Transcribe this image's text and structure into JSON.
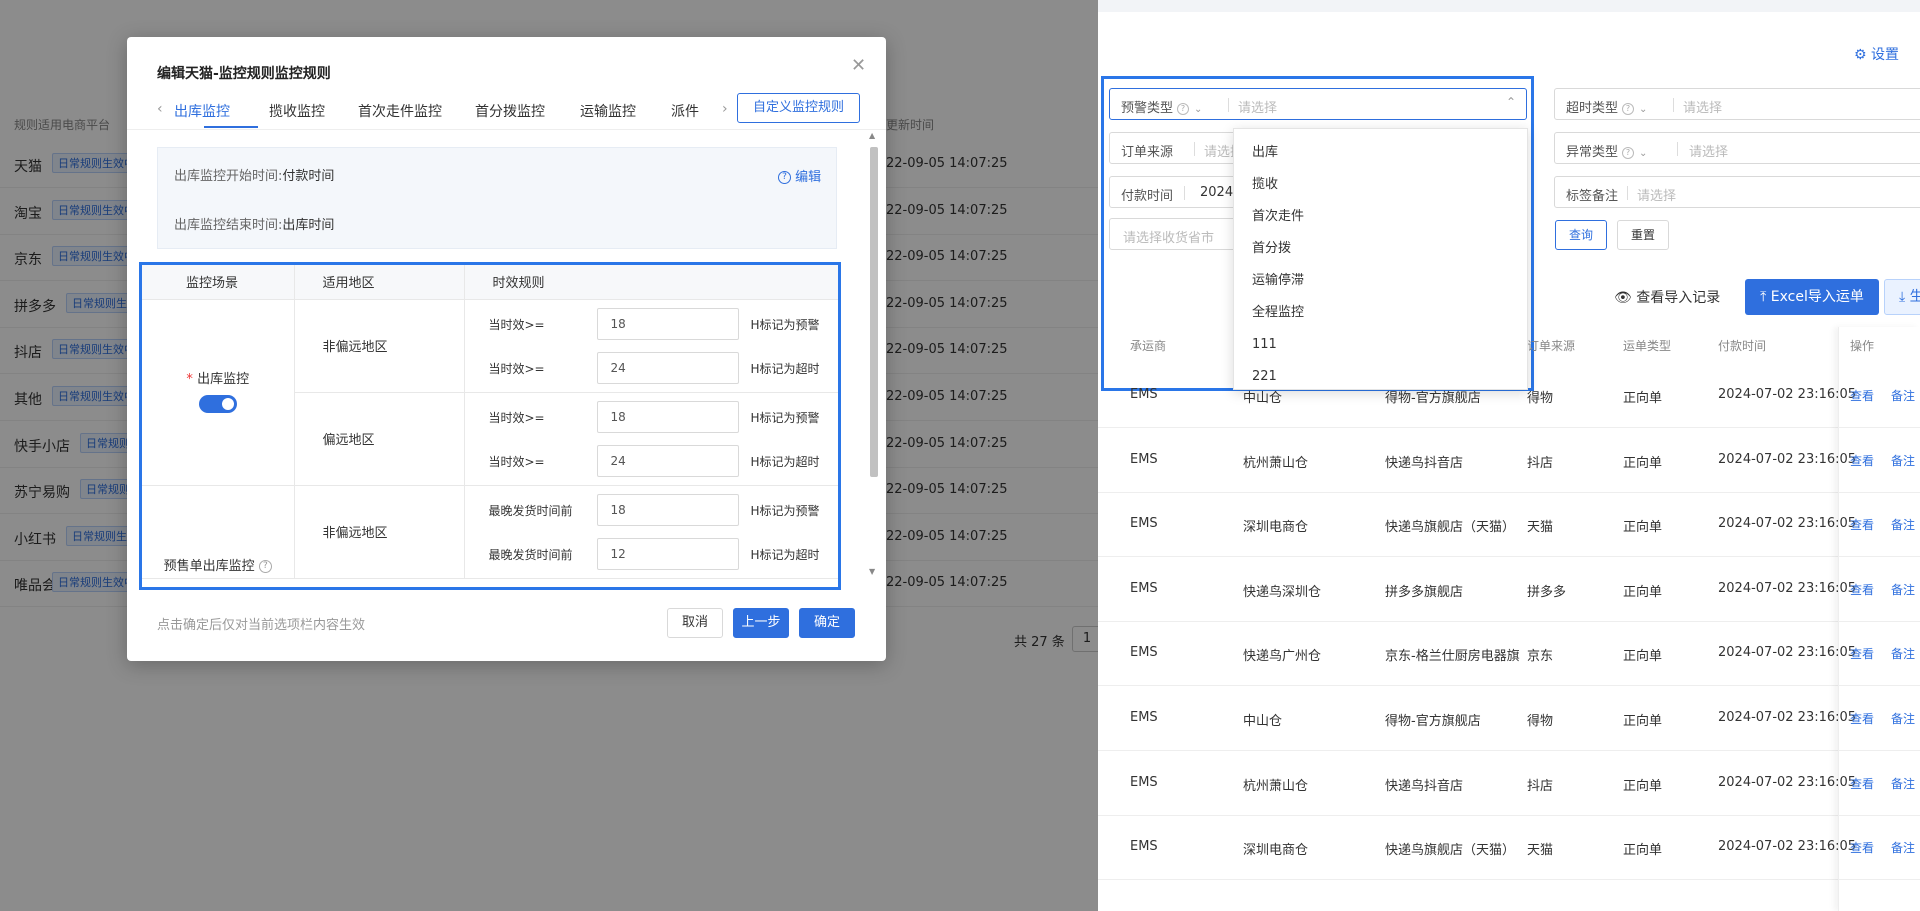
{
  "background_page": {
    "column_header": "规则适用电商平台",
    "time_header": "更新时间",
    "rows": [
      {
        "platform": "天猫",
        "tag": "日常规则生效中"
      },
      {
        "platform": "淘宝",
        "tag": "日常规则生效中"
      },
      {
        "platform": "京东",
        "tag": "日常规则生效中"
      },
      {
        "platform": "拼多多",
        "tag": "日常规则生效中"
      },
      {
        "platform": "抖店",
        "tag": "日常规则生效中"
      },
      {
        "platform": "其他",
        "tag": "日常规则生效中"
      },
      {
        "platform": "快手小店",
        "tag": "日常规则生效中"
      },
      {
        "platform": "苏宁易购",
        "tag": "日常规则生效中"
      },
      {
        "platform": "小红书",
        "tag": "日常规则生效中"
      },
      {
        "platform": "唯品会",
        "tag": "日常规则生效中"
      }
    ],
    "time_value": "22-09-05 14:07:25",
    "total": "共 27 条",
    "page": "1"
  },
  "modal": {
    "title": "编辑天猫-监控规则监控规则",
    "tabs": [
      "出库监控",
      "揽收监控",
      "首次走件监控",
      "首分拨监控",
      "运输监控",
      "派件"
    ],
    "active_tab": "出库监控",
    "custom_rule_button": "自定义监控规则",
    "info": {
      "start_label": "出库监控开始时间:",
      "start_value": "付款时间",
      "end_label": "出库监控结束时间:",
      "end_value": "出库时间",
      "edit": "编辑"
    },
    "table": {
      "headers": [
        "监控场景",
        "适用地区",
        "时效规则"
      ],
      "scenarios": [
        {
          "name": "出库监控",
          "enabled": true,
          "regions": [
            {
              "region": "非偏远地区",
              "rules": [
                {
                  "label": "当时效>=",
                  "value": "18",
                  "suffix": "H标记为预警"
                },
                {
                  "label": "当时效>=",
                  "value": "24",
                  "suffix": "H标记为超时"
                }
              ]
            },
            {
              "region": "偏远地区",
              "rules": [
                {
                  "label": "当时效>=",
                  "value": "18",
                  "suffix": "H标记为预警"
                },
                {
                  "label": "当时效>=",
                  "value": "24",
                  "suffix": "H标记为超时"
                }
              ]
            }
          ]
        },
        {
          "name": "预售单出库监控",
          "regions": [
            {
              "region": "非偏远地区",
              "rules": [
                {
                  "label": "最晚发货时间前",
                  "value": "18",
                  "suffix": "H标记为预警"
                },
                {
                  "label": "最晚发货时间前",
                  "value": "12",
                  "suffix": "H标记为超时"
                }
              ]
            }
          ]
        }
      ]
    },
    "footer_note": "点击确定后仅对当前选项栏内容生效",
    "buttons": {
      "cancel": "取消",
      "prev": "上一步",
      "ok": "确定"
    }
  },
  "right": {
    "settings": "设置",
    "filters": {
      "alert_type": {
        "label": "预警类型",
        "placeholder": "请选择"
      },
      "timeout_type": {
        "label": "超时类型",
        "placeholder": "请选择"
      },
      "order_source": {
        "label": "订单来源",
        "placeholder": "请选择"
      },
      "exception_type": {
        "label": "异常类型",
        "placeholder": "请选择"
      },
      "pay_time": {
        "label": "付款时间",
        "value": "2024"
      },
      "tag_note": {
        "label": "标签备注",
        "placeholder": "请选择"
      },
      "region_placeholder": "请选择收货省市"
    },
    "dropdown_options": [
      "出库",
      "揽收",
      "首次走件",
      "首分拨",
      "运输停滞",
      "全程监控",
      "111",
      "221"
    ],
    "query": "查询",
    "reset": "重置",
    "import_log": "查看导入记录",
    "excel_import": "Excel导入运单",
    "more_button": "生",
    "table": {
      "headers": {
        "carrier": "承运商",
        "source": "订单来源",
        "type": "运单类型",
        "pay_time": "付款时间",
        "op": "操作"
      },
      "rows": [
        {
          "carrier": "EMS",
          "warehouse": "中山仓",
          "shop": "得物-官方旗舰店",
          "source": "得物",
          "type": "正向单",
          "pay_time": "2024-07-02 23:16:05"
        },
        {
          "carrier": "EMS",
          "warehouse": "杭州萧山仓",
          "shop": "快递鸟抖音店",
          "source": "抖店",
          "type": "正向单",
          "pay_time": "2024-07-02 23:16:05"
        },
        {
          "carrier": "EMS",
          "warehouse": "深圳电商仓",
          "shop": "快递鸟旗舰店（天猫）",
          "source": "天猫",
          "type": "正向单",
          "pay_time": "2024-07-02 23:16:05"
        },
        {
          "carrier": "EMS",
          "warehouse": "快递鸟深圳仓",
          "shop": "拼多多旗舰店",
          "source": "拼多多",
          "type": "正向单",
          "pay_time": "2024-07-02 23:16:05"
        },
        {
          "carrier": "EMS",
          "warehouse": "快递鸟广州仓",
          "shop": "京东-格兰仕厨房电器旗",
          "source": "京东",
          "type": "正向单",
          "pay_time": "2024-07-02 23:16:05"
        },
        {
          "carrier": "EMS",
          "warehouse": "中山仓",
          "shop": "得物-官方旗舰店",
          "source": "得物",
          "type": "正向单",
          "pay_time": "2024-07-02 23:16:05"
        },
        {
          "carrier": "EMS",
          "warehouse": "杭州萧山仓",
          "shop": "快递鸟抖音店",
          "source": "抖店",
          "type": "正向单",
          "pay_time": "2024-07-02 23:16:05"
        },
        {
          "carrier": "EMS",
          "warehouse": "深圳电商仓",
          "shop": "快递鸟旗舰店（天猫）",
          "source": "天猫",
          "type": "正向单",
          "pay_time": "2024-07-02 23:16:05"
        }
      ],
      "op_view": "查看",
      "op_note": "备注"
    }
  }
}
